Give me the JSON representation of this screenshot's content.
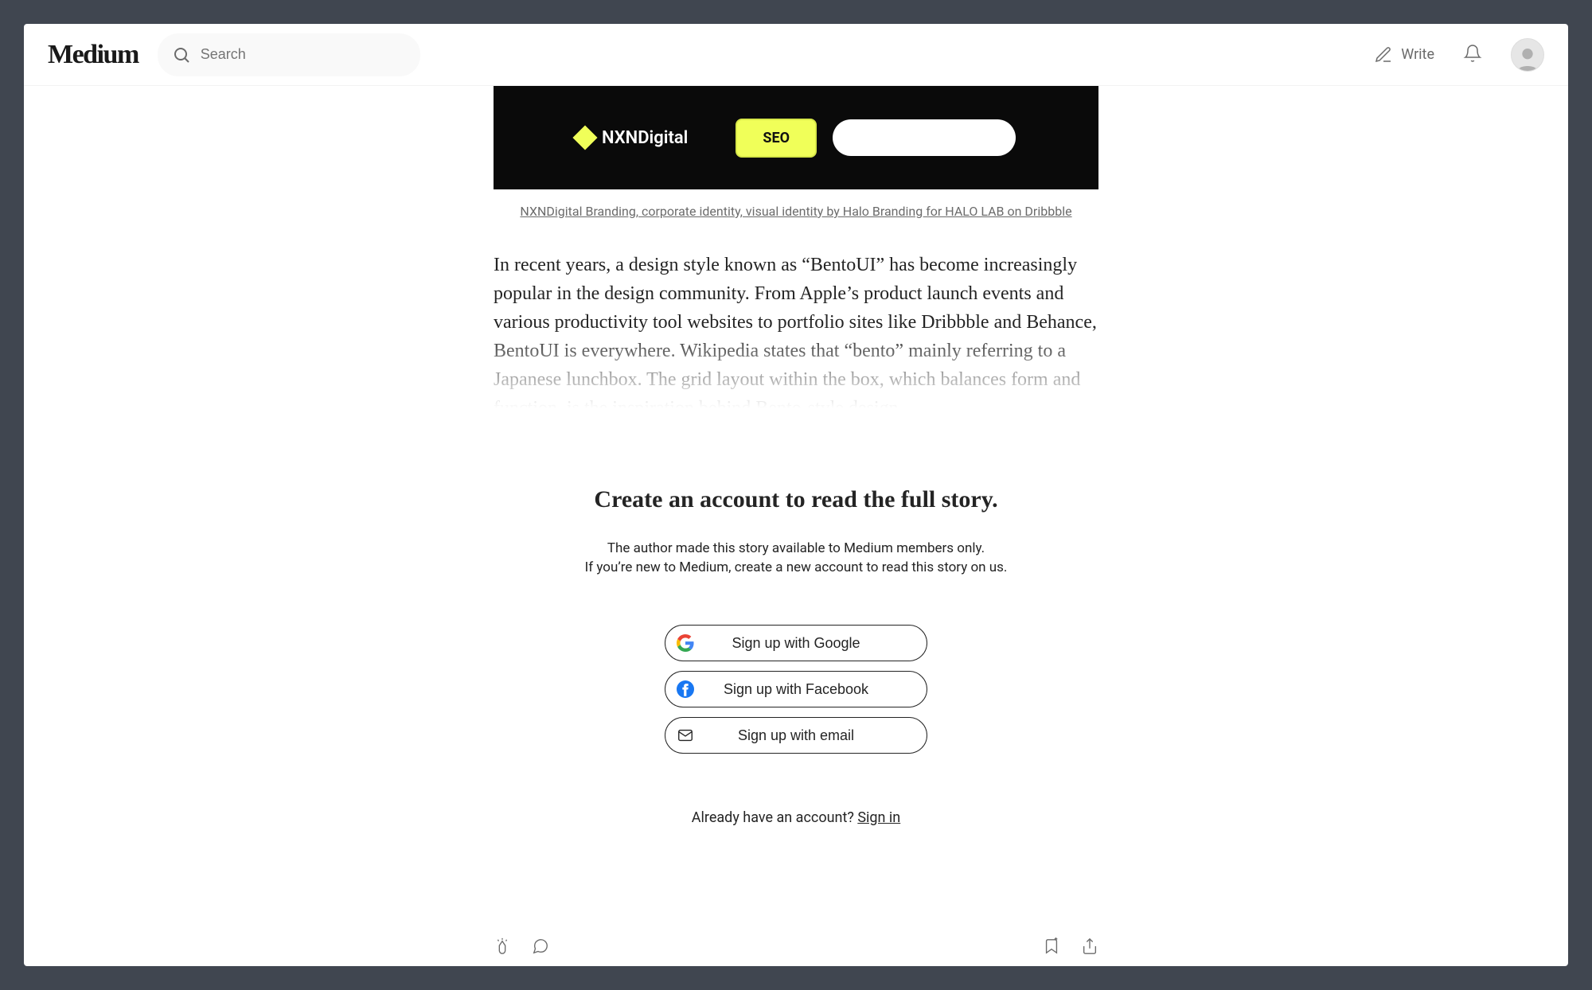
{
  "header": {
    "logo": "Medium",
    "search_placeholder": "Search",
    "write_label": "Write"
  },
  "article": {
    "caption_text": "NXNDigital Branding, corporate identity, visual identity by Halo Branding for HALO LAB on Dribbble",
    "body_text": "In recent years, a design style known as “BentoUI” has become increasingly popular in the design community. From Apple’s product launch events and various productivity tool websites to portfolio sites like Dribbble and Behance, BentoUI is everywhere. Wikipedia states that “bento” mainly referring to a Japanese lunchbox. The grid layout within the box, which balances form and function, is the inspiration behind Bento-style design."
  },
  "paywall": {
    "title": "Create an account to read the full story.",
    "sub_line1": "The author made this story available to Medium members only.",
    "sub_line2": "If you’re new to Medium, create a new account to read this story on us.",
    "google_label": "Sign up with Google",
    "facebook_label": "Sign up with Facebook",
    "email_label": "Sign up with email",
    "already_text": "Already have an account? ",
    "signin_label": "Sign in"
  },
  "hero": {
    "brand_text": "NXNDigital",
    "pill_text": "SEO"
  }
}
